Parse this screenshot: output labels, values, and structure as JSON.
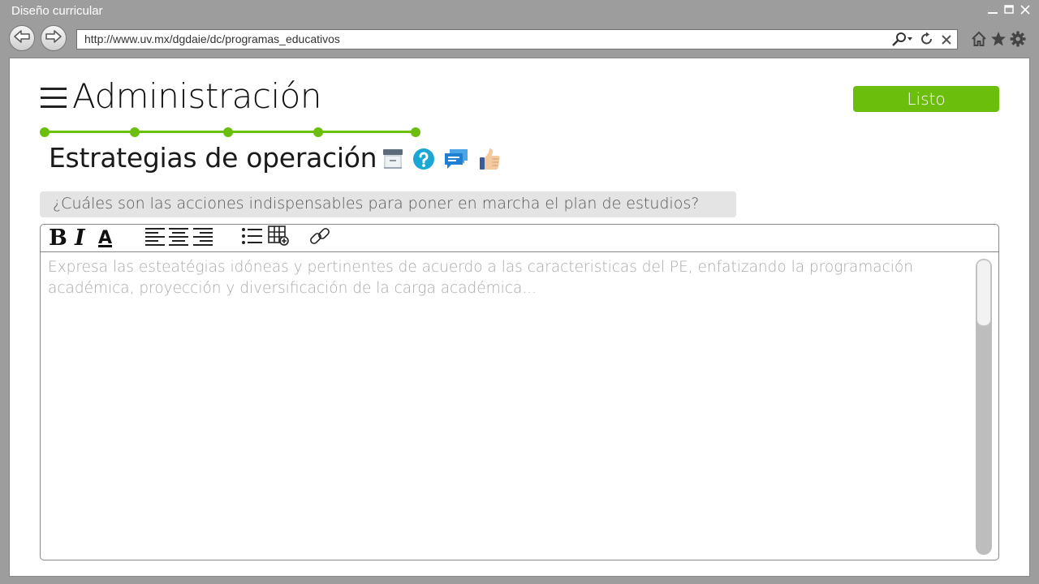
{
  "window": {
    "title": "Diseño curricular"
  },
  "browser": {
    "url": "http://www.uv.mx/dgdaie/dc/programas_educativos"
  },
  "header": {
    "title": "Administración",
    "done_label": "Listo"
  },
  "progress": {
    "steps": 5,
    "completed_steps": 5
  },
  "section": {
    "title": "Estrategias de operación"
  },
  "question": {
    "text": "¿Cuáles son las acciones indispensables para poner en marcha el plan de estudios?"
  },
  "editor": {
    "toolbar": {
      "bold_label": "B",
      "italic_label": "I",
      "font_color_label": "A"
    },
    "placeholder": "Expresa las esteatégias idóneas y pertinentes de acuerdo a las caracteristicas del PE, enfatizando la programación académica, proyección y diversificación de la carga académica..."
  },
  "colors": {
    "accent": "#6bbf0c",
    "question_bg": "#e4e4e4",
    "help_icon": "#1aa7d6",
    "chat_icon": "#1f7fd1"
  },
  "icons": {
    "section": [
      "archive-icon",
      "help-icon",
      "chat-icon",
      "thumbs-up-icon"
    ]
  }
}
